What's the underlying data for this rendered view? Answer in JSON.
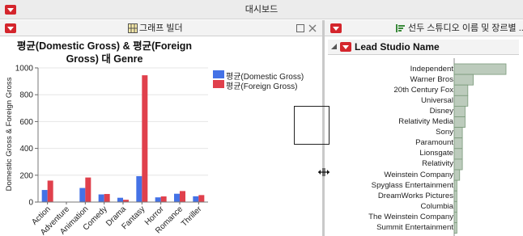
{
  "dashboard": {
    "title": "대시보드"
  },
  "left_panel": {
    "title": "그래프 빌더"
  },
  "right_panel": {
    "title": "선두 스튜디오 이름 및 장르별 ..."
  },
  "outline": {
    "title": "Lead Studio Name"
  },
  "colors": {
    "domestic": "#4472e6",
    "foreign": "#e0404c",
    "studio_bar": "#bccbbc",
    "studio_bar_stroke": "#7a9a7a",
    "menu_red": "#d4252c"
  },
  "chart_data": [
    {
      "type": "bar",
      "title": "평균(Domestic Gross) & 평균(Foreign Gross) 대 Genre",
      "title_lines": [
        "평균(Domestic Gross) & 평균(Foreign",
        "Gross) 대 Genre"
      ],
      "ylabel": "Domestic Gross & Foreign Gross",
      "xlabel": "",
      "ylim": [
        0,
        1000
      ],
      "yticks": [
        "0",
        "200",
        "400",
        "600",
        "800",
        "1000"
      ],
      "categories": [
        "Action",
        "Adventure",
        "Animation",
        "Comedy",
        "Drama",
        "Fantasy",
        "Horror",
        "Romance",
        "Thriller"
      ],
      "series": [
        {
          "name": "평균(Domestic Gross)",
          "values": [
            90,
            0,
            105,
            57,
            32,
            193,
            35,
            62,
            43
          ]
        },
        {
          "name": "평균(Foreign Gross)",
          "values": [
            160,
            0,
            183,
            60,
            17,
            945,
            42,
            82,
            52
          ]
        }
      ],
      "legend_placement": "right"
    },
    {
      "type": "bar",
      "orientation": "horizontal",
      "title": "Lead Studio Name",
      "categories": [
        "Independent",
        "Warner Bros",
        "20th Century Fox",
        "Universal",
        "Disney",
        "Relativity Media",
        "Sony",
        "Paramount",
        "Lionsgate",
        "Relativity",
        "Weinstein Company",
        "Spyglass Entertainment",
        "DreamWorks Pictures",
        "Columbia",
        "The Weinstein Company",
        "Summit Entertainment"
      ],
      "values": [
        19,
        7,
        5,
        5,
        4,
        4,
        3,
        3,
        3,
        3,
        2,
        1,
        1,
        1,
        1,
        1
      ]
    }
  ]
}
